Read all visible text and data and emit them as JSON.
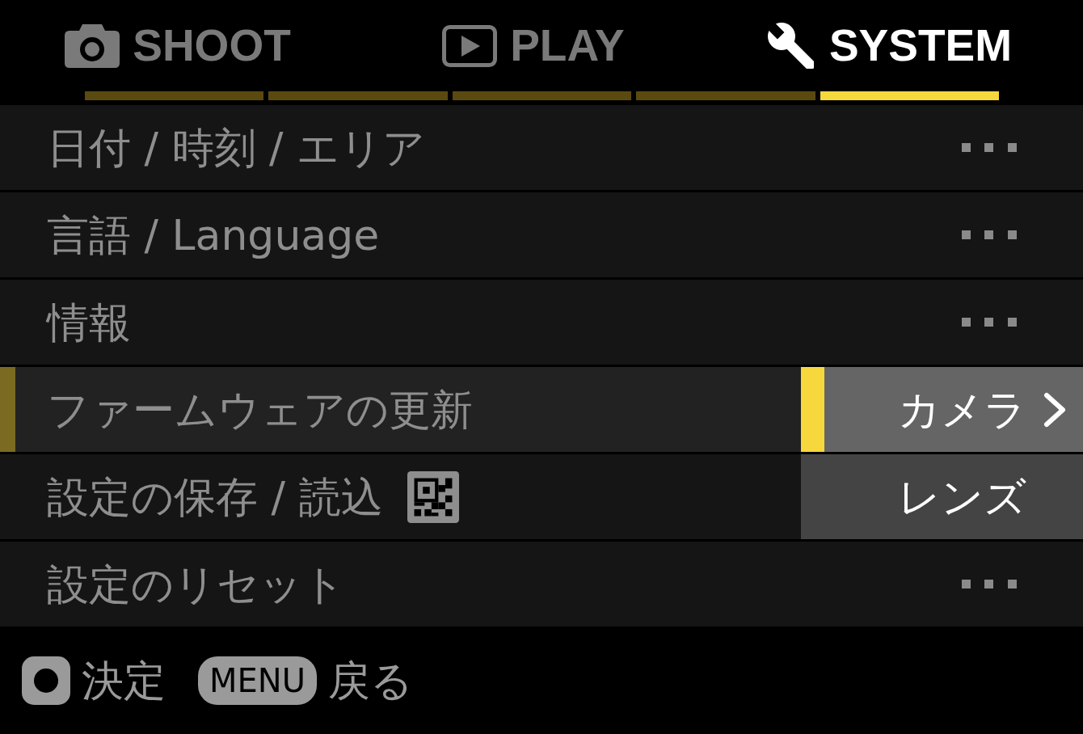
{
  "tabs": [
    {
      "label": "SHOOT",
      "selected": false
    },
    {
      "label": "PLAY",
      "selected": false
    },
    {
      "label": "SYSTEM",
      "selected": true
    }
  ],
  "page_indicator": [
    {
      "selected": false
    },
    {
      "selected": false
    },
    {
      "selected": false
    },
    {
      "selected": false
    },
    {
      "selected": true
    }
  ],
  "menu": {
    "items": [
      {
        "label": "日付 / 時刻 / エリア",
        "kind": "more",
        "selected": false
      },
      {
        "label": "言語 / Language",
        "kind": "more",
        "selected": false
      },
      {
        "label": "情報",
        "kind": "more",
        "selected": false
      },
      {
        "label": "ファームウェアの更新",
        "kind": "plain",
        "selected": true
      },
      {
        "label": "設定の保存 / 読込",
        "kind": "qr",
        "selected": false
      },
      {
        "label": "設定のリセット",
        "kind": "more",
        "selected": false
      }
    ]
  },
  "submenu": {
    "items": [
      {
        "label": "カメラ",
        "selected": true
      },
      {
        "label": "レンズ",
        "selected": false
      }
    ]
  },
  "footer": {
    "hints": [
      {
        "kind": "ok",
        "label": "決定"
      },
      {
        "kind": "key",
        "key": "MENU",
        "label": "戻る"
      }
    ]
  }
}
